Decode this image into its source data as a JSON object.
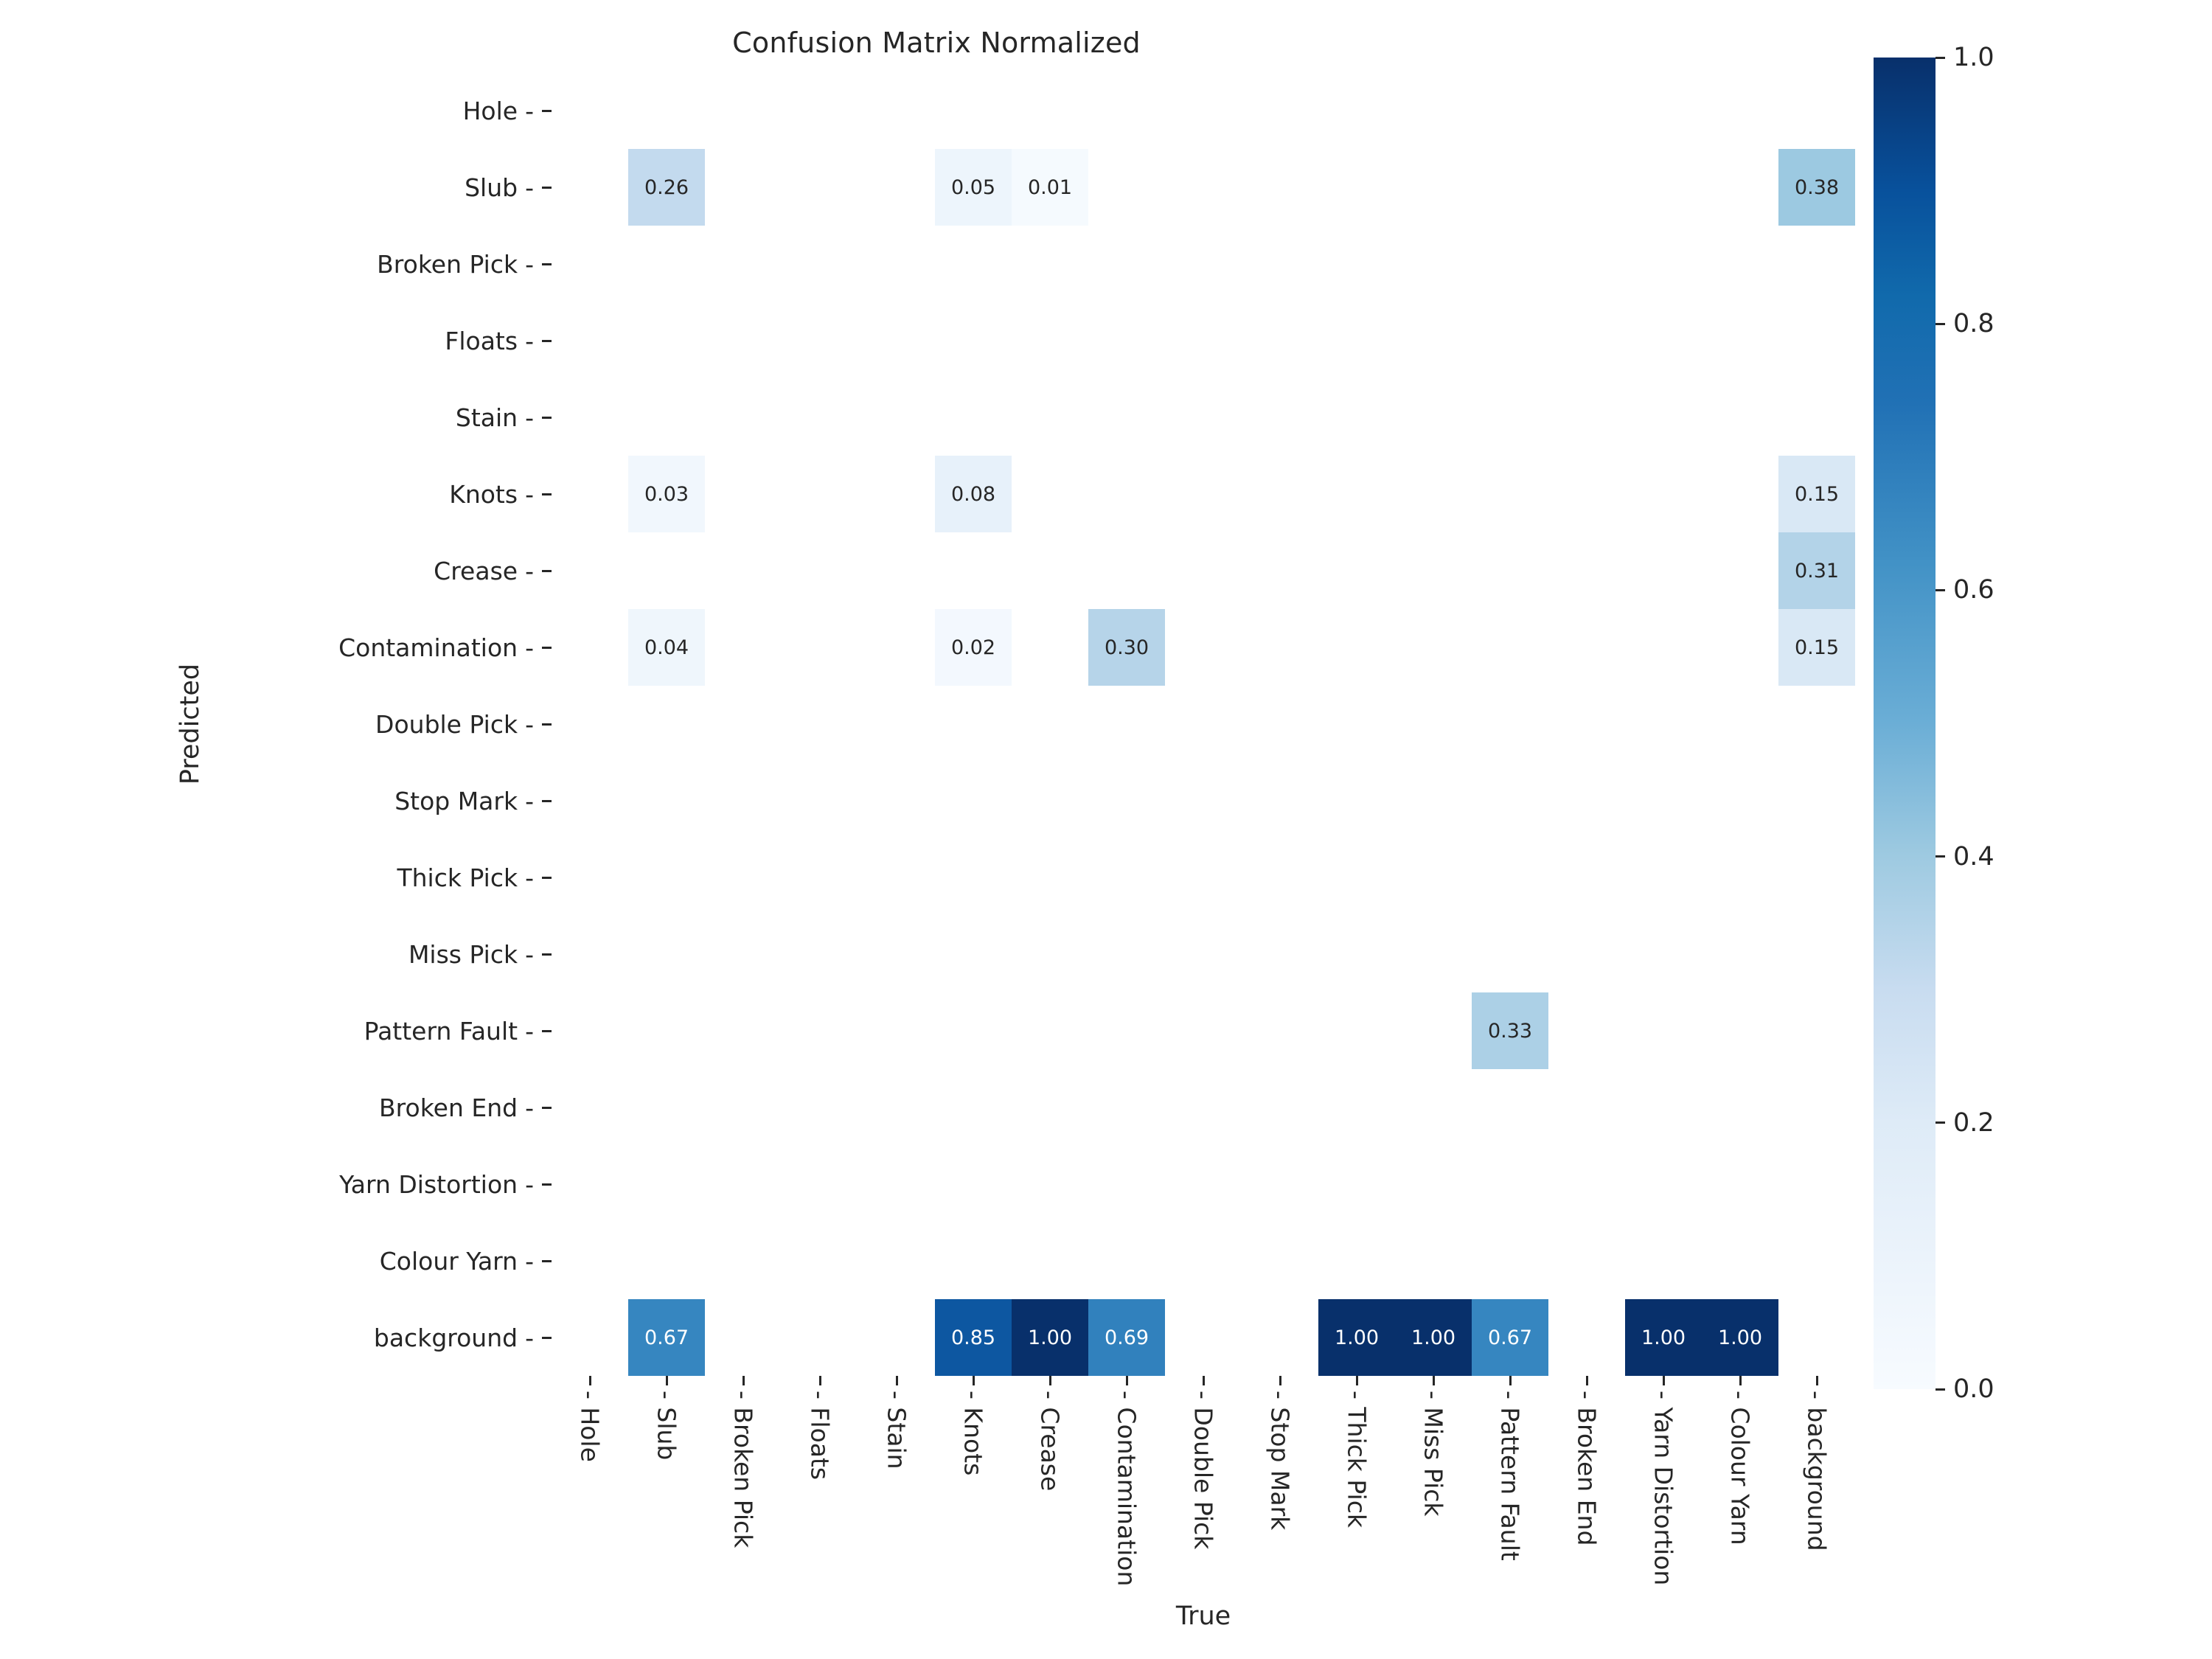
{
  "title": "Confusion Matrix Normalized",
  "axes": {
    "xlabel": "True",
    "ylabel": "Predicted",
    "tick_dash": "-"
  },
  "colorbar": {
    "ticks": [
      "0.0",
      "0.2",
      "0.4",
      "0.6",
      "0.8",
      "1.0"
    ],
    "values": [
      0.0,
      0.2,
      0.4,
      0.6,
      0.8,
      1.0
    ],
    "colormap": "Blues",
    "vmin": 0.0,
    "vmax": 1.0,
    "low_color": "#f7fbff",
    "high_color": "#08306b"
  },
  "chart_data": {
    "type": "heatmap",
    "title": "Confusion Matrix Normalized",
    "xlabel": "True",
    "ylabel": "Predicted",
    "colormap": "Blues",
    "vmin": 0.0,
    "vmax": 1.0,
    "grid": false,
    "legend_position": "right",
    "annotation_format": "0.00",
    "x_categories": [
      "Hole",
      "Slub",
      "Broken Pick",
      "Floats",
      "Stain",
      "Knots",
      "Crease",
      "Contamination",
      "Double Pick",
      "Stop Mark",
      "Thick Pick",
      "Miss Pick",
      "Pattern Fault",
      "Broken End",
      "Yarn Distortion",
      "Colour Yarn",
      "background"
    ],
    "y_categories": [
      "Hole",
      "Slub",
      "Broken Pick",
      "Floats",
      "Stain",
      "Knots",
      "Crease",
      "Contamination",
      "Double Pick",
      "Stop Mark",
      "Thick Pick",
      "Miss Pick",
      "Pattern Fault",
      "Broken End",
      "Yarn Distortion",
      "Colour Yarn",
      "background"
    ],
    "cells": [
      {
        "row": "Slub",
        "col": "Slub",
        "value": 0.26,
        "label": "0.26"
      },
      {
        "row": "Slub",
        "col": "Knots",
        "value": 0.05,
        "label": "0.05"
      },
      {
        "row": "Slub",
        "col": "Crease",
        "value": 0.01,
        "label": "0.01"
      },
      {
        "row": "Slub",
        "col": "background",
        "value": 0.38,
        "label": "0.38"
      },
      {
        "row": "Knots",
        "col": "Slub",
        "value": 0.03,
        "label": "0.03"
      },
      {
        "row": "Knots",
        "col": "Knots",
        "value": 0.08,
        "label": "0.08"
      },
      {
        "row": "Knots",
        "col": "background",
        "value": 0.15,
        "label": "0.15"
      },
      {
        "row": "Crease",
        "col": "background",
        "value": 0.31,
        "label": "0.31"
      },
      {
        "row": "Contamination",
        "col": "Slub",
        "value": 0.04,
        "label": "0.04"
      },
      {
        "row": "Contamination",
        "col": "Knots",
        "value": 0.02,
        "label": "0.02"
      },
      {
        "row": "Contamination",
        "col": "Contamination",
        "value": 0.3,
        "label": "0.30"
      },
      {
        "row": "Contamination",
        "col": "background",
        "value": 0.15,
        "label": "0.15"
      },
      {
        "row": "Pattern Fault",
        "col": "Pattern Fault",
        "value": 0.33,
        "label": "0.33"
      },
      {
        "row": "background",
        "col": "Slub",
        "value": 0.67,
        "label": "0.67"
      },
      {
        "row": "background",
        "col": "Knots",
        "value": 0.85,
        "label": "0.85"
      },
      {
        "row": "background",
        "col": "Crease",
        "value": 1.0,
        "label": "1.00"
      },
      {
        "row": "background",
        "col": "Contamination",
        "value": 0.69,
        "label": "0.69"
      },
      {
        "row": "background",
        "col": "Thick Pick",
        "value": 1.0,
        "label": "1.00"
      },
      {
        "row": "background",
        "col": "Miss Pick",
        "value": 1.0,
        "label": "1.00"
      },
      {
        "row": "background",
        "col": "Pattern Fault",
        "value": 0.67,
        "label": "0.67"
      },
      {
        "row": "background",
        "col": "Yarn Distortion",
        "value": 1.0,
        "label": "1.00"
      },
      {
        "row": "background",
        "col": "Colour Yarn",
        "value": 1.0,
        "label": "1.00"
      }
    ]
  }
}
